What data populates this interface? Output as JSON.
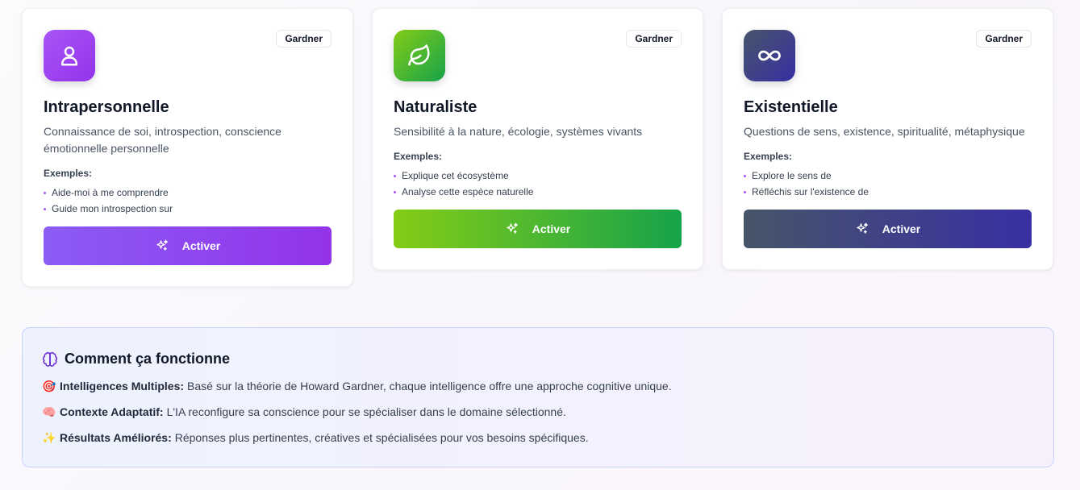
{
  "cards": [
    {
      "title": "Intrapersonnelle",
      "badge": "Gardner",
      "icon": "user-icon",
      "description": "Connaissance de soi, introspection, conscience émotionnelle personnelle",
      "examples_title": "Exemples:",
      "examples": [
        "Aide-moi à me comprendre",
        "Guide mon introspection sur"
      ],
      "button_label": "Activer",
      "colors": {
        "from": "#8b5cf6",
        "to": "#9333ea",
        "dot": "#a855f7"
      }
    },
    {
      "title": "Naturaliste",
      "badge": "Gardner",
      "icon": "leaf-icon",
      "description": "Sensibilité à la nature, écologie, systèmes vivants",
      "examples_title": "Exemples:",
      "examples": [
        "Explique cet écosystème",
        "Analyse cette espèce naturelle"
      ],
      "button_label": "Activer",
      "colors": {
        "from": "#84cc16",
        "to": "#16a34a",
        "dot": "#a855f7"
      }
    },
    {
      "title": "Existentielle",
      "badge": "Gardner",
      "icon": "infinity-icon",
      "description": "Questions de sens, existence, spiritualité, métaphysique",
      "examples_title": "Exemples:",
      "examples": [
        "Explore le sens de",
        "Réfléchis sur l'existence de"
      ],
      "button_label": "Activer",
      "colors": {
        "from": "#475569",
        "to": "#3730a3",
        "dot": "#a855f7"
      }
    }
  ],
  "info": {
    "title": "Comment ça fonctionne",
    "icon": "brain-icon",
    "items": [
      {
        "emoji": "🎯",
        "label": "Intelligences Multiples:",
        "text": "Basé sur la théorie de Howard Gardner, chaque intelligence offre une approche cognitive unique."
      },
      {
        "emoji": "🧠",
        "label": "Contexte Adaptatif:",
        "text": "L'IA reconfigure sa conscience pour se spécialiser dans le domaine sélectionné."
      },
      {
        "emoji": "✨",
        "label": "Résultats Améliorés:",
        "text": "Réponses plus pertinentes, créatives et spécialisées pour vos besoins spécifiques."
      }
    ]
  }
}
